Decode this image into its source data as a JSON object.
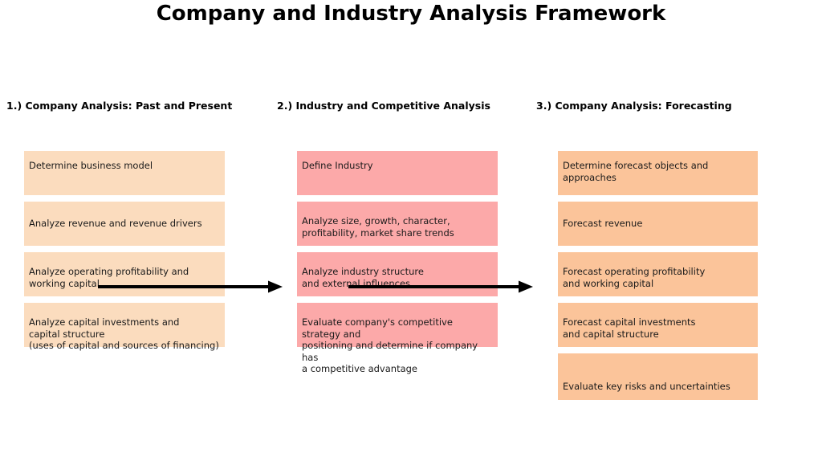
{
  "title": "Company and Industry Analysis Framework",
  "colors": {
    "background": "#ffffff",
    "column1_fill": "#fbdcbe",
    "column2_fill": "#fca9a9",
    "column3_fill": "#fbc49a",
    "arrow": "#000000",
    "text": "#1a1a1a",
    "heading": "#000000"
  },
  "columns": [
    {
      "header": "1.) Company Analysis: Past and Present",
      "fill": "#fbdcbe",
      "boxes": [
        {
          "text": "Determine business model"
        },
        {
          "text": "Analyze revenue and revenue drivers"
        },
        {
          "text": "Analyze operating profitability and\n working capital"
        },
        {
          "text": "Analyze capital investments and\ncapital structure\n(uses of capital and sources of financing)"
        }
      ]
    },
    {
      "header": "2.) Industry and Competitive Analysis",
      "fill": "#fca9a9",
      "boxes": [
        {
          "text": "Define Industry"
        },
        {
          "text": "Analyze size, growth, character,\nprofitability, market share trends"
        },
        {
          "text": "Analyze industry structure\nand external influences"
        },
        {
          "text": "Evaluate company's competitive strategy and\npositioning and determine if company has\na competitive advantage"
        }
      ]
    },
    {
      "header": "3.) Company Analysis: Forecasting",
      "fill": "#fbc49a",
      "boxes": [
        {
          "text": "Determine forecast objects and approaches"
        },
        {
          "text": "Forecast revenue"
        },
        {
          "text": "Forecast operating profitability\n and working capital"
        },
        {
          "text": "Forecast capital investments\nand capital structure"
        },
        {
          "text": "Evaluate key risks and uncertainties"
        }
      ]
    }
  ],
  "arrows": [
    {
      "name": "arrow-column1-to-column2",
      "direction": "right"
    },
    {
      "name": "arrow-column2-to-column3",
      "direction": "right"
    }
  ]
}
